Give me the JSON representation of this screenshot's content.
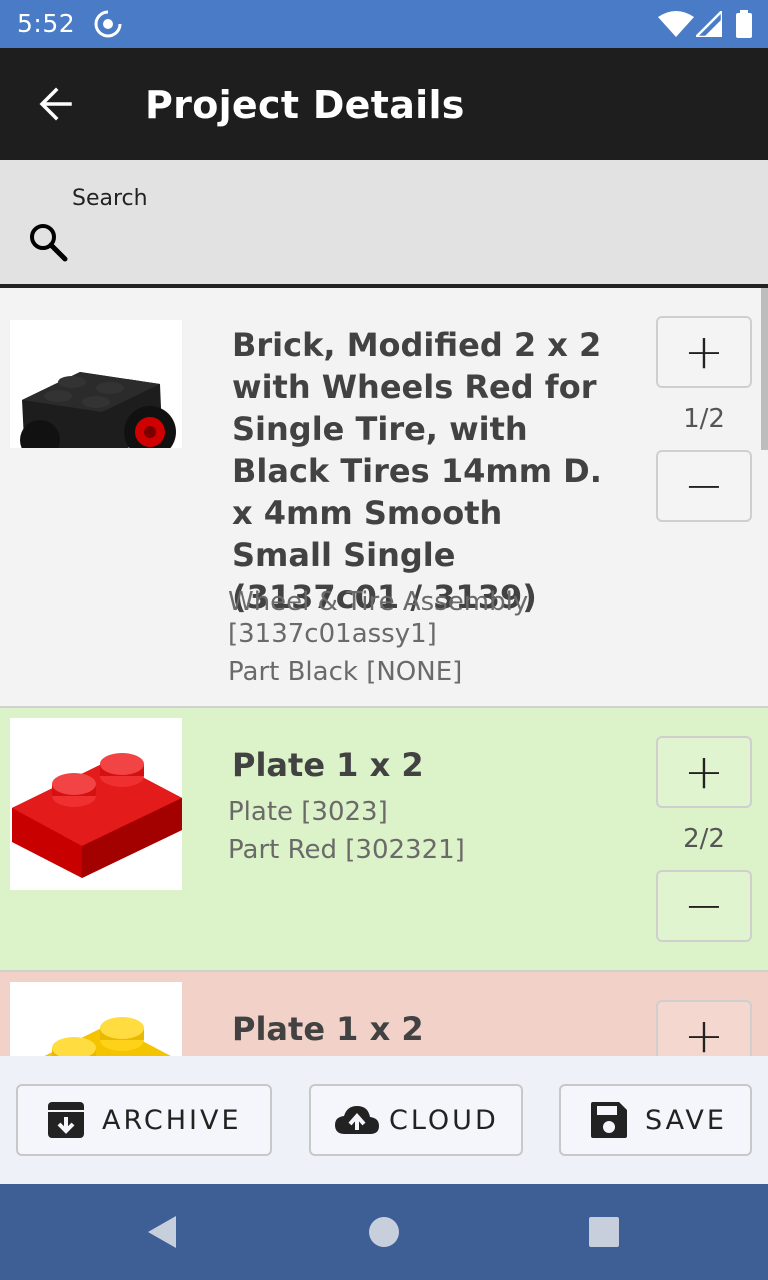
{
  "status_bar": {
    "time": "5:52"
  },
  "app_bar": {
    "title": "Project Details"
  },
  "search": {
    "label": "Search",
    "value": ""
  },
  "items": [
    {
      "name": "Brick, Modified 2 x 2 with Wheels Red for Single Tire, with Black Tires 14mm D. x 4mm Smooth Small Single (3137c01 / 3139)",
      "category": "Wheel & Tire Assembly [3137c01assy1]",
      "part": "Part Black [NONE]",
      "count": "1/2",
      "background": "#f3f3f3"
    },
    {
      "name": "Plate 1 x 2",
      "category": "Plate [3023]",
      "part": "Part Red [302321]",
      "count": "2/2",
      "background": "#dcf2c8"
    },
    {
      "name": "Plate 1 x 2",
      "category": "",
      "part": "",
      "count": "",
      "background": "#f2d2c8"
    }
  ],
  "actions": {
    "archive": "ARCHIVE",
    "cloud": "CLOUD",
    "save": "SAVE"
  },
  "colors": {
    "status_bar": "#4a7bc6",
    "app_bar": "#1e1e1e",
    "nav_bar": "#3d5f96"
  }
}
